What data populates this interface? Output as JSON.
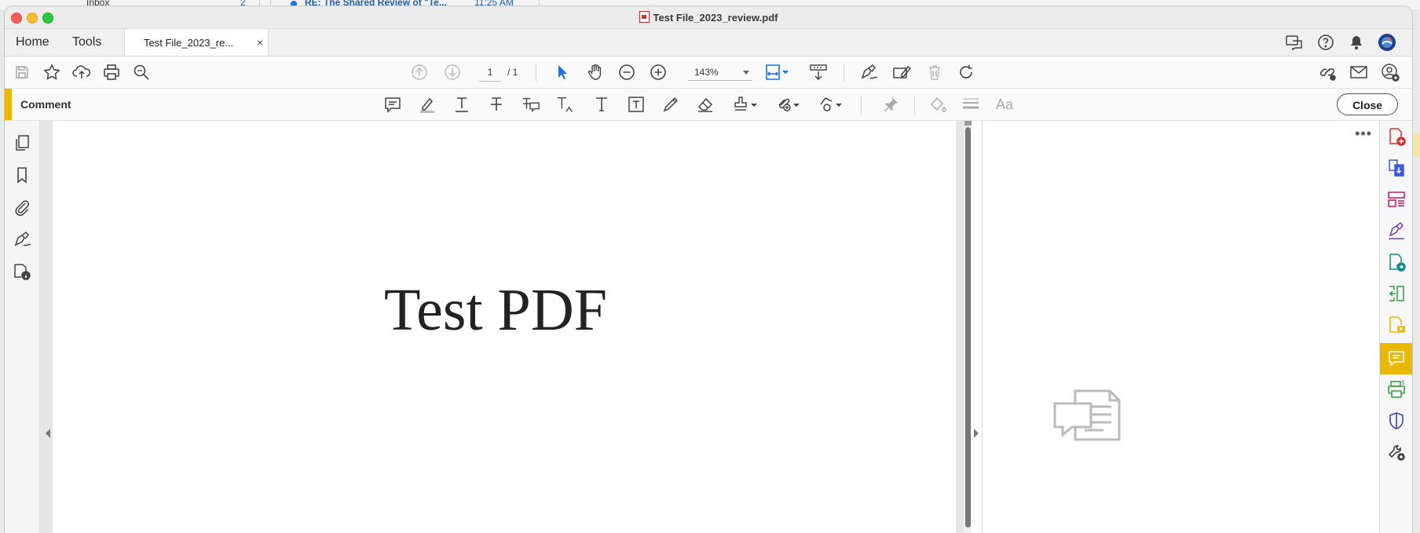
{
  "background": {
    "inbox_label": "Inbox",
    "inbox_count": "2",
    "mail_subject": "RE: The Shared Review of \"Te...",
    "mail_time": "11:25 AM"
  },
  "window": {
    "title": "Test File_2023_review.pdf"
  },
  "tabs": {
    "home": "Home",
    "tools": "Tools",
    "file_tab": "Test File_2023_re...",
    "close_tab": "×"
  },
  "toolbar": {
    "page_current": "1",
    "page_total": "/ 1",
    "zoom": "143%"
  },
  "comment_bar": {
    "label": "Comment",
    "close_label": "Close"
  },
  "document": {
    "title_text": "Test PDF"
  },
  "right_pane": {
    "more_label": "•••"
  },
  "colors": {
    "accent_yellow": "#e8b900",
    "select_blue": "#1a73e8",
    "rail_red": "#d6322f",
    "rail_blue": "#3b5bdb",
    "rail_magenta": "#c2185b",
    "rail_purple": "#7b3fb5",
    "rail_teal": "#0f8b8d",
    "rail_green": "#2e9e3f",
    "rail_lime": "#7cb342",
    "rail_indigo": "#3949ab"
  },
  "icons": {
    "toolbar": [
      "save-icon",
      "star-icon",
      "upload-cloud-icon",
      "print-icon",
      "search-zoom-icon",
      "page-up-icon",
      "page-down-icon",
      "select-arrow-icon",
      "hand-icon",
      "zoom-out-icon",
      "zoom-in-icon",
      "fit-page-icon",
      "scroll-mode-icon",
      "sign-icon",
      "fill-sign-icon",
      "delete-icon",
      "rotate-icon",
      "share-link-icon",
      "email-icon",
      "account-icon"
    ],
    "comment": [
      "sticky-note-icon",
      "highlight-icon",
      "underline-text-icon",
      "strikethrough-icon",
      "replace-text-icon",
      "insert-text-icon",
      "add-text-icon",
      "text-box-icon",
      "pencil-icon",
      "eraser-icon",
      "stamp-icon",
      "attach-icon",
      "shapes-icon",
      "pin-icon",
      "fill-color-icon",
      "line-weight-icon",
      "text-font-icon"
    ],
    "left_panel": [
      "page-thumbnails-icon",
      "bookmark-icon",
      "attachment-icon",
      "signature-panel-icon",
      "document-info-icon"
    ],
    "rail": [
      "create-pdf-icon",
      "export-pdf-icon",
      "organize-pages-icon",
      "fill-sign-rail-icon",
      "edit-pdf-icon",
      "compress-icon",
      "request-signature-icon",
      "comment-rail-icon",
      "scan-ocr-icon",
      "protect-icon",
      "more-tools-icon"
    ]
  }
}
